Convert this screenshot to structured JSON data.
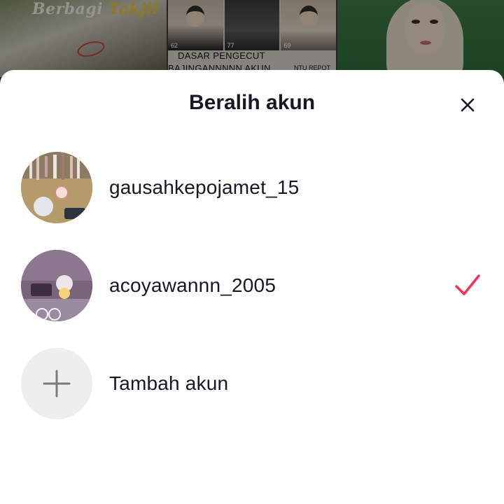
{
  "background_feed": {
    "tile1_title": "Berbagi",
    "tile1_title_highlight": "Takjil",
    "thumb_counts": [
      "62",
      "77",
      "69"
    ],
    "tile2_line1": "DASAR PENGECUT",
    "tile2_line2": "BAJINGANNNNN AKUN",
    "tile2_line3": "NTU REPOT"
  },
  "sheet": {
    "title": "Beralih akun",
    "close_icon": "close-icon"
  },
  "accounts": [
    {
      "username": "gausahkepojamet_15",
      "selected": false
    },
    {
      "username": "acoyawannn_2005",
      "selected": true
    }
  ],
  "add_account": {
    "label": "Tambah akun",
    "icon": "plus-icon"
  },
  "colors": {
    "check_accent": "#fe2c55",
    "text_primary": "#161823",
    "add_circle_bg": "#eeeeee"
  }
}
